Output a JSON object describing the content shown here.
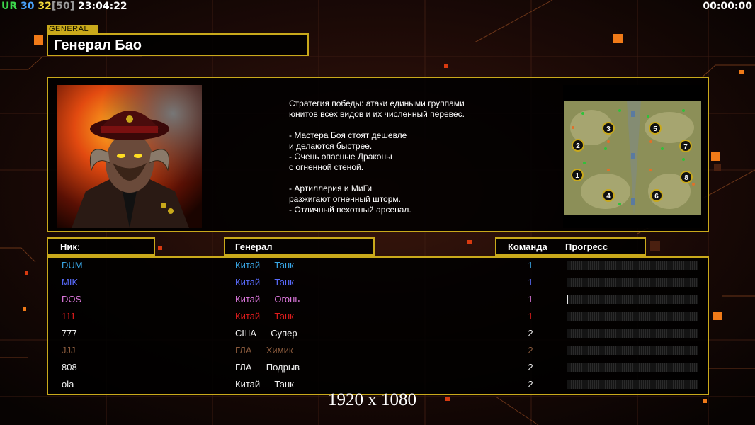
{
  "hud": {
    "tag": "UR",
    "fps": "30",
    "fps_target": "32",
    "fps_cap": "[50]",
    "clock": "23:04:22",
    "timer": "00:00:00",
    "colors": {
      "tag": "#3cd64b",
      "fps": "#4aa3ff",
      "fps_target": "#f2d93a",
      "fps_cap": "#9a9a9a",
      "clock": "#ffffff"
    }
  },
  "general": {
    "tag": "GENERAL",
    "name": "Генерал Бао",
    "portrait_icon": "demon-general-portrait",
    "description": [
      "Стратегия победы: атаки едиными группами",
      "юнитов всех видов и их численный перевес.",
      "",
      "- Мастера Боя стоят дешевле",
      "и делаются быстрее.",
      "- Очень опасные Драконы",
      "с огненной стеной.",
      "",
      "- Артиллерия и МиГи",
      "разжигают огненный шторм.",
      "- Отличный пехотный арсенал."
    ]
  },
  "minimap": {
    "start_positions": [
      "1",
      "2",
      "3",
      "4",
      "5",
      "6",
      "7",
      "8"
    ]
  },
  "columns": {
    "nick": "Ник:",
    "general": "Генерал",
    "team": "Команда",
    "progress": "Прогресс"
  },
  "players": [
    {
      "nick": "DUM",
      "general": "Китай — Танк",
      "team": "1",
      "color": "#3aa8e8",
      "progress": 0
    },
    {
      "nick": "MIK",
      "general": "Китай — Танк",
      "team": "1",
      "color": "#5a6cff",
      "progress": 0
    },
    {
      "nick": "DOS",
      "general": "Китай — Огонь",
      "team": "1",
      "color": "#e07ae0",
      "progress": 0.01
    },
    {
      "nick": "111",
      "general": "Китай — Танк",
      "team": "1",
      "color": "#e11d1d",
      "progress": 0
    },
    {
      "nick": "777",
      "general": "США — Супер",
      "team": "2",
      "color": "#f0f0f0",
      "progress": 0
    },
    {
      "nick": "JJJ",
      "general": "ГЛА — Химик",
      "team": "2",
      "color": "#8a5a3c",
      "progress": 0
    },
    {
      "nick": "808",
      "general": "ГЛА — Подрыв",
      "team": "2",
      "color": "#f0f0f0",
      "progress": 0
    },
    {
      "nick": "ola",
      "general": "Китай — Танк",
      "team": "2",
      "color": "#f0f0f0",
      "progress": 0
    }
  ],
  "resolution_label": "1920 x 1080",
  "accent_color": "#c9a91b"
}
